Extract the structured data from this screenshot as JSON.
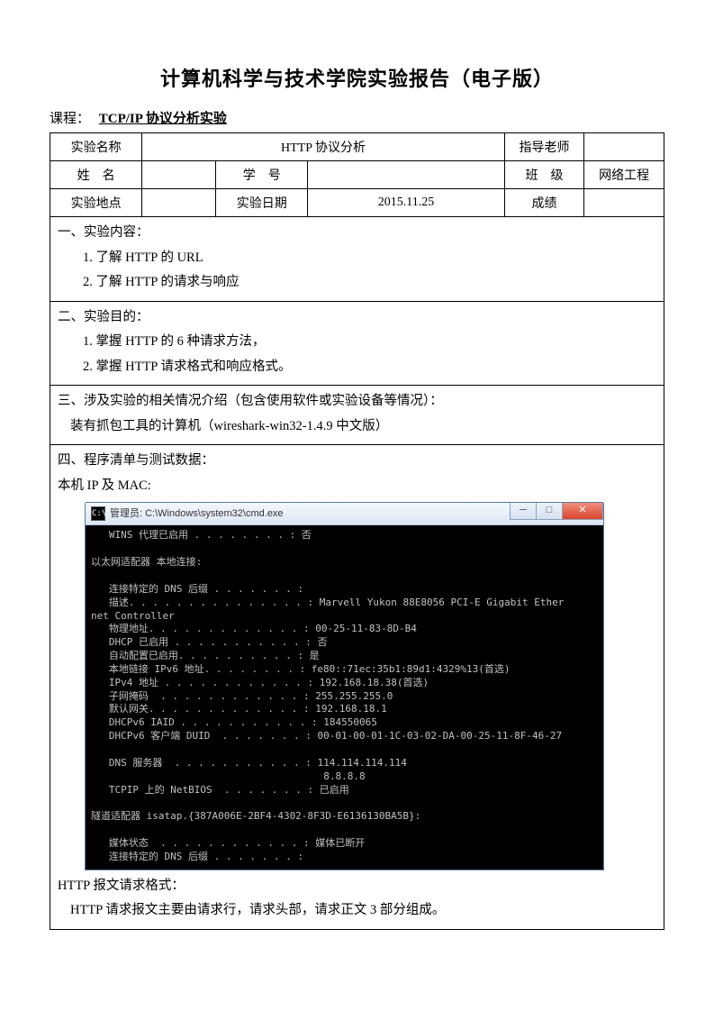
{
  "title": "计算机科学与技术学院实验报告（电子版）",
  "course_label": "课程：",
  "course_value": "TCP/IP 协议分析实验",
  "meta": {
    "row1": {
      "c1": "实验名称",
      "c2": "HTTP 协议分析",
      "c3": "指导老师",
      "c4": ""
    },
    "row2": {
      "c1": "姓　名",
      "c2": "学　号",
      "c3": "",
      "c4": "班　级",
      "c5": "网络工程"
    },
    "row3": {
      "c1": "实验地点",
      "c2": "",
      "c3": "实验日期",
      "c4": "2015.11.25",
      "c5": "成绩",
      "c6": ""
    }
  },
  "sec1": {
    "heading": "一、实验内容：",
    "l1": "1. 了解 HTTP 的 URL",
    "l2": "2. 了解 HTTP 的请求与响应"
  },
  "sec2": {
    "heading": "二、实验目的：",
    "l1": "1. 掌握 HTTP 的 6 种请求方法，",
    "l2": "2. 掌握 HTTP 请求格式和响应格式。"
  },
  "sec3": {
    "heading": "三、涉及实验的相关情况介绍（包含使用软件或实验设备等情况）：",
    "l1": "装有抓包工具的计算机（wireshark-win32-1.4.9 中文版）"
  },
  "sec4": {
    "heading": "四、程序清单与测试数据：",
    "subhead1": "本机 IP 及 MAC:",
    "subhead2": "HTTP 报文请求格式：",
    "l_end": "HTTP 请求报文主要由请求行，请求头部，请求正文 3 部分组成。"
  },
  "terminal": {
    "title": "管理员: C:\\Windows\\system32\\cmd.exe",
    "body": "   WINS 代理已启用 . . . . . . . . : 否\n\n以太网适配器 本地连接:\n\n   连接特定的 DNS 后缀 . . . . . . . :\n   描述. . . . . . . . . . . . . . . : Marvell Yukon 88E8056 PCI-E Gigabit Ether\nnet Controller\n   物理地址. . . . . . . . . . . . . : 00-25-11-83-8D-B4\n   DHCP 已启用 . . . . . . . . . . . : 否\n   自动配置已启用. . . . . . . . . . : 是\n   本地链接 IPv6 地址. . . . . . . . : fe80::71ec:35b1:89d1:4329%13(首选)\n   IPv4 地址 . . . . . . . . . . . . : 192.168.18.38(首选)\n   子网掩码  . . . . . . . . . . . . : 255.255.255.0\n   默认网关. . . . . . . . . . . . . : 192.168.18.1\n   DHCPv6 IAID . . . . . . . . . . . : 184550065\n   DHCPv6 客户端 DUID  . . . . . . . : 00-01-00-01-1C-03-02-DA-00-25-11-8F-46-27\n\n   DNS 服务器  . . . . . . . . . . . : 114.114.114.114\n                                       8.8.8.8\n   TCPIP 上的 NetBIOS  . . . . . . . : 已启用\n\n隧道适配器 isatap.{387A006E-2BF4-4302-8F3D-E6136130BA5B}:\n\n   媒体状态  . . . . . . . . . . . . : 媒体已断开\n   连接特定的 DNS 后缀 . . . . . . . :"
  }
}
